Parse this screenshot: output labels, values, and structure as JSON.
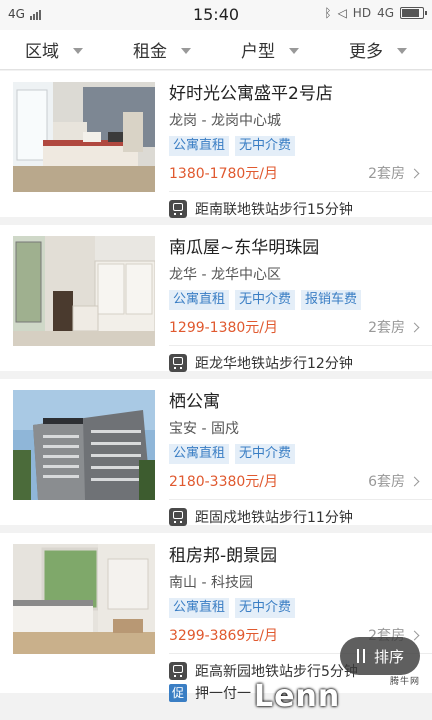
{
  "status_bar": {
    "network": "4G",
    "network_right": "4G",
    "time": "15:40",
    "hd": "HD"
  },
  "filters": [
    {
      "label": "区域"
    },
    {
      "label": "租金"
    },
    {
      "label": "户型"
    },
    {
      "label": "更多"
    }
  ],
  "listings": [
    {
      "title": "好时光公寓盛平2号店",
      "area": "龙岗 - 龙岗中心城",
      "tags": [
        "公寓直租",
        "无中介费"
      ],
      "price": "1380-1780元/月",
      "rooms": "2套房",
      "metro": "距南联地铁站步行15分钟"
    },
    {
      "title": "南瓜屋~东华明珠园",
      "area": "龙华 - 龙华中心区",
      "tags": [
        "公寓直租",
        "无中介费",
        "报销车费"
      ],
      "price": "1299-1380元/月",
      "rooms": "2套房",
      "metro": "距龙华地铁站步行12分钟"
    },
    {
      "title": "栖公寓",
      "area": "宝安 - 固戍",
      "tags": [
        "公寓直租",
        "无中介费"
      ],
      "price": "2180-3380元/月",
      "rooms": "6套房",
      "metro": "距固戍地铁站步行11分钟"
    },
    {
      "title": "租房邦-朗景园",
      "area": "南山 - 科技园",
      "tags": [
        "公寓直租",
        "无中介费"
      ],
      "price": "3299-3869元/月",
      "rooms": "2套房",
      "metro": "距高新园地铁站步行5分钟",
      "promo_icon": "促",
      "promo": "押一付一"
    }
  ],
  "sort_button": {
    "label": "排序"
  },
  "overlay_watermark": {
    "text": "Lenn",
    "site": "腾牛网"
  },
  "icons": [
    "metro-icon",
    "sort-icon",
    "chevron-right-icon",
    "caret-down-icon",
    "battery-icon",
    "signal-icon"
  ],
  "colors": {
    "price": "#e0592f",
    "tag_text": "#3a7ec4",
    "tag_bg": "#e4eef8"
  }
}
